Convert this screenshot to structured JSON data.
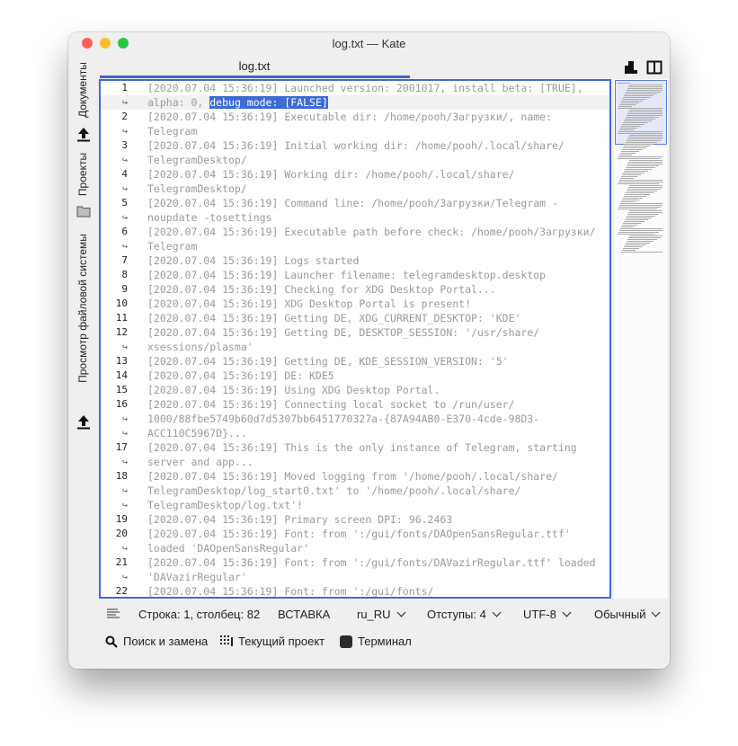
{
  "window": {
    "title": "log.txt — Kate"
  },
  "sidebar": {
    "items": [
      {
        "label": "Документы"
      },
      {
        "label": "Проекты"
      },
      {
        "label": "Просмотр файловой системы"
      }
    ]
  },
  "tabs": [
    {
      "label": "log.txt"
    }
  ],
  "editor": {
    "wrap_marker": "↪",
    "lines": [
      {
        "n": "1",
        "parts": [
          {
            "t": "[2020.07.04 15:36:19] Launched version: 2001017, install beta: [TRUE],"
          },
          {
            "t": "alpha: 0, ",
            "sel_next": true
          }
        ]
      },
      {
        "n": "2",
        "parts": [
          {
            "t": "[2020.07.04 15:36:19] Executable dir: /home/pooh/Загрузки/, name:"
          },
          {
            "t": "Telegram"
          }
        ]
      },
      {
        "n": "3",
        "parts": [
          {
            "t": "[2020.07.04 15:36:19] Initial working dir: /home/pooh/.local/share/"
          },
          {
            "t": "TelegramDesktop/"
          }
        ]
      },
      {
        "n": "4",
        "parts": [
          {
            "t": "[2020.07.04 15:36:19] Working dir: /home/pooh/.local/share/"
          },
          {
            "t": "TelegramDesktop/"
          }
        ]
      },
      {
        "n": "5",
        "parts": [
          {
            "t": "[2020.07.04 15:36:19] Command line: /home/pooh/Загрузки/Telegram -"
          },
          {
            "t": "noupdate -tosettings"
          }
        ]
      },
      {
        "n": "6",
        "parts": [
          {
            "t": "[2020.07.04 15:36:19] Executable path before check: /home/pooh/Загрузки/"
          },
          {
            "t": "Telegram"
          }
        ]
      },
      {
        "n": "7",
        "parts": [
          {
            "t": "[2020.07.04 15:36:19] Logs started"
          }
        ]
      },
      {
        "n": "8",
        "parts": [
          {
            "t": "[2020.07.04 15:36:19] Launcher filename: telegramdesktop.desktop"
          }
        ]
      },
      {
        "n": "9",
        "parts": [
          {
            "t": "[2020.07.04 15:36:19] Checking for XDG Desktop Portal..."
          }
        ]
      },
      {
        "n": "10",
        "parts": [
          {
            "t": "[2020.07.04 15:36:19] XDG Desktop Portal is present!"
          }
        ]
      },
      {
        "n": "11",
        "parts": [
          {
            "t": "[2020.07.04 15:36:19] Getting DE, XDG_CURRENT_DESKTOP: 'KDE'"
          }
        ]
      },
      {
        "n": "12",
        "parts": [
          {
            "t": "[2020.07.04 15:36:19] Getting DE, DESKTOP_SESSION: '/usr/share/"
          },
          {
            "t": "xsessions/plasma'"
          }
        ]
      },
      {
        "n": "13",
        "parts": [
          {
            "t": "[2020.07.04 15:36:19] Getting DE, KDE_SESSION_VERSION: '5'"
          }
        ]
      },
      {
        "n": "14",
        "parts": [
          {
            "t": "[2020.07.04 15:36:19] DE: KDE5"
          }
        ]
      },
      {
        "n": "15",
        "parts": [
          {
            "t": "[2020.07.04 15:36:19] Using XDG Desktop Portal."
          }
        ]
      },
      {
        "n": "16",
        "parts": [
          {
            "t": "[2020.07.04 15:36:19] Connecting local socket to /run/user/"
          },
          {
            "t": "1000/88fbe5749b60d7d5307bb6451770327a-{87A94AB0-E370-4cde-98D3-"
          },
          {
            "t": "ACC110C5967D}..."
          }
        ]
      },
      {
        "n": "17",
        "parts": [
          {
            "t": "[2020.07.04 15:36:19] This is the only instance of Telegram, starting"
          },
          {
            "t": "server and app..."
          }
        ]
      },
      {
        "n": "18",
        "parts": [
          {
            "t": "[2020.07.04 15:36:19] Moved logging from '/home/pooh/.local/share/"
          },
          {
            "t": "TelegramDesktop/log_start0.txt' to '/home/pooh/.local/share/"
          },
          {
            "t": "TelegramDesktop/log.txt'!"
          }
        ]
      },
      {
        "n": "19",
        "parts": [
          {
            "t": "[2020.07.04 15:36:19] Primary screen DPI: 96.2463"
          }
        ]
      },
      {
        "n": "20",
        "parts": [
          {
            "t": "[2020.07.04 15:36:19] Font: from ':/gui/fonts/DAOpenSansRegular.ttf'"
          },
          {
            "t": "loaded 'DAOpenSansRegular'"
          }
        ]
      },
      {
        "n": "21",
        "parts": [
          {
            "t": "[2020.07.04 15:36:19] Font: from ':/gui/fonts/DAVazirRegular.ttf' loaded"
          },
          {
            "t": "'DAVazirRegular'"
          }
        ]
      },
      {
        "n": "22",
        "parts": [
          {
            "t": "[2020.07.04 15:36:19] Font: from ':/gui/fonts/"
          }
        ]
      }
    ],
    "selection": "debug mode: [FALSE]"
  },
  "statusbar": {
    "position": "Строка: 1, столбец: 82",
    "mode": "ВСТАВКА",
    "language": "ru_RU",
    "indent": "Отступы: 4",
    "encoding": "UTF-8",
    "highlighting": "Обычный"
  },
  "toolbar": {
    "search": "Поиск и замена",
    "project": "Текущий проект",
    "terminal": "Терминал"
  },
  "colors": {
    "accent": "#3b6bd4",
    "text_dim": "#9a9a9a"
  }
}
